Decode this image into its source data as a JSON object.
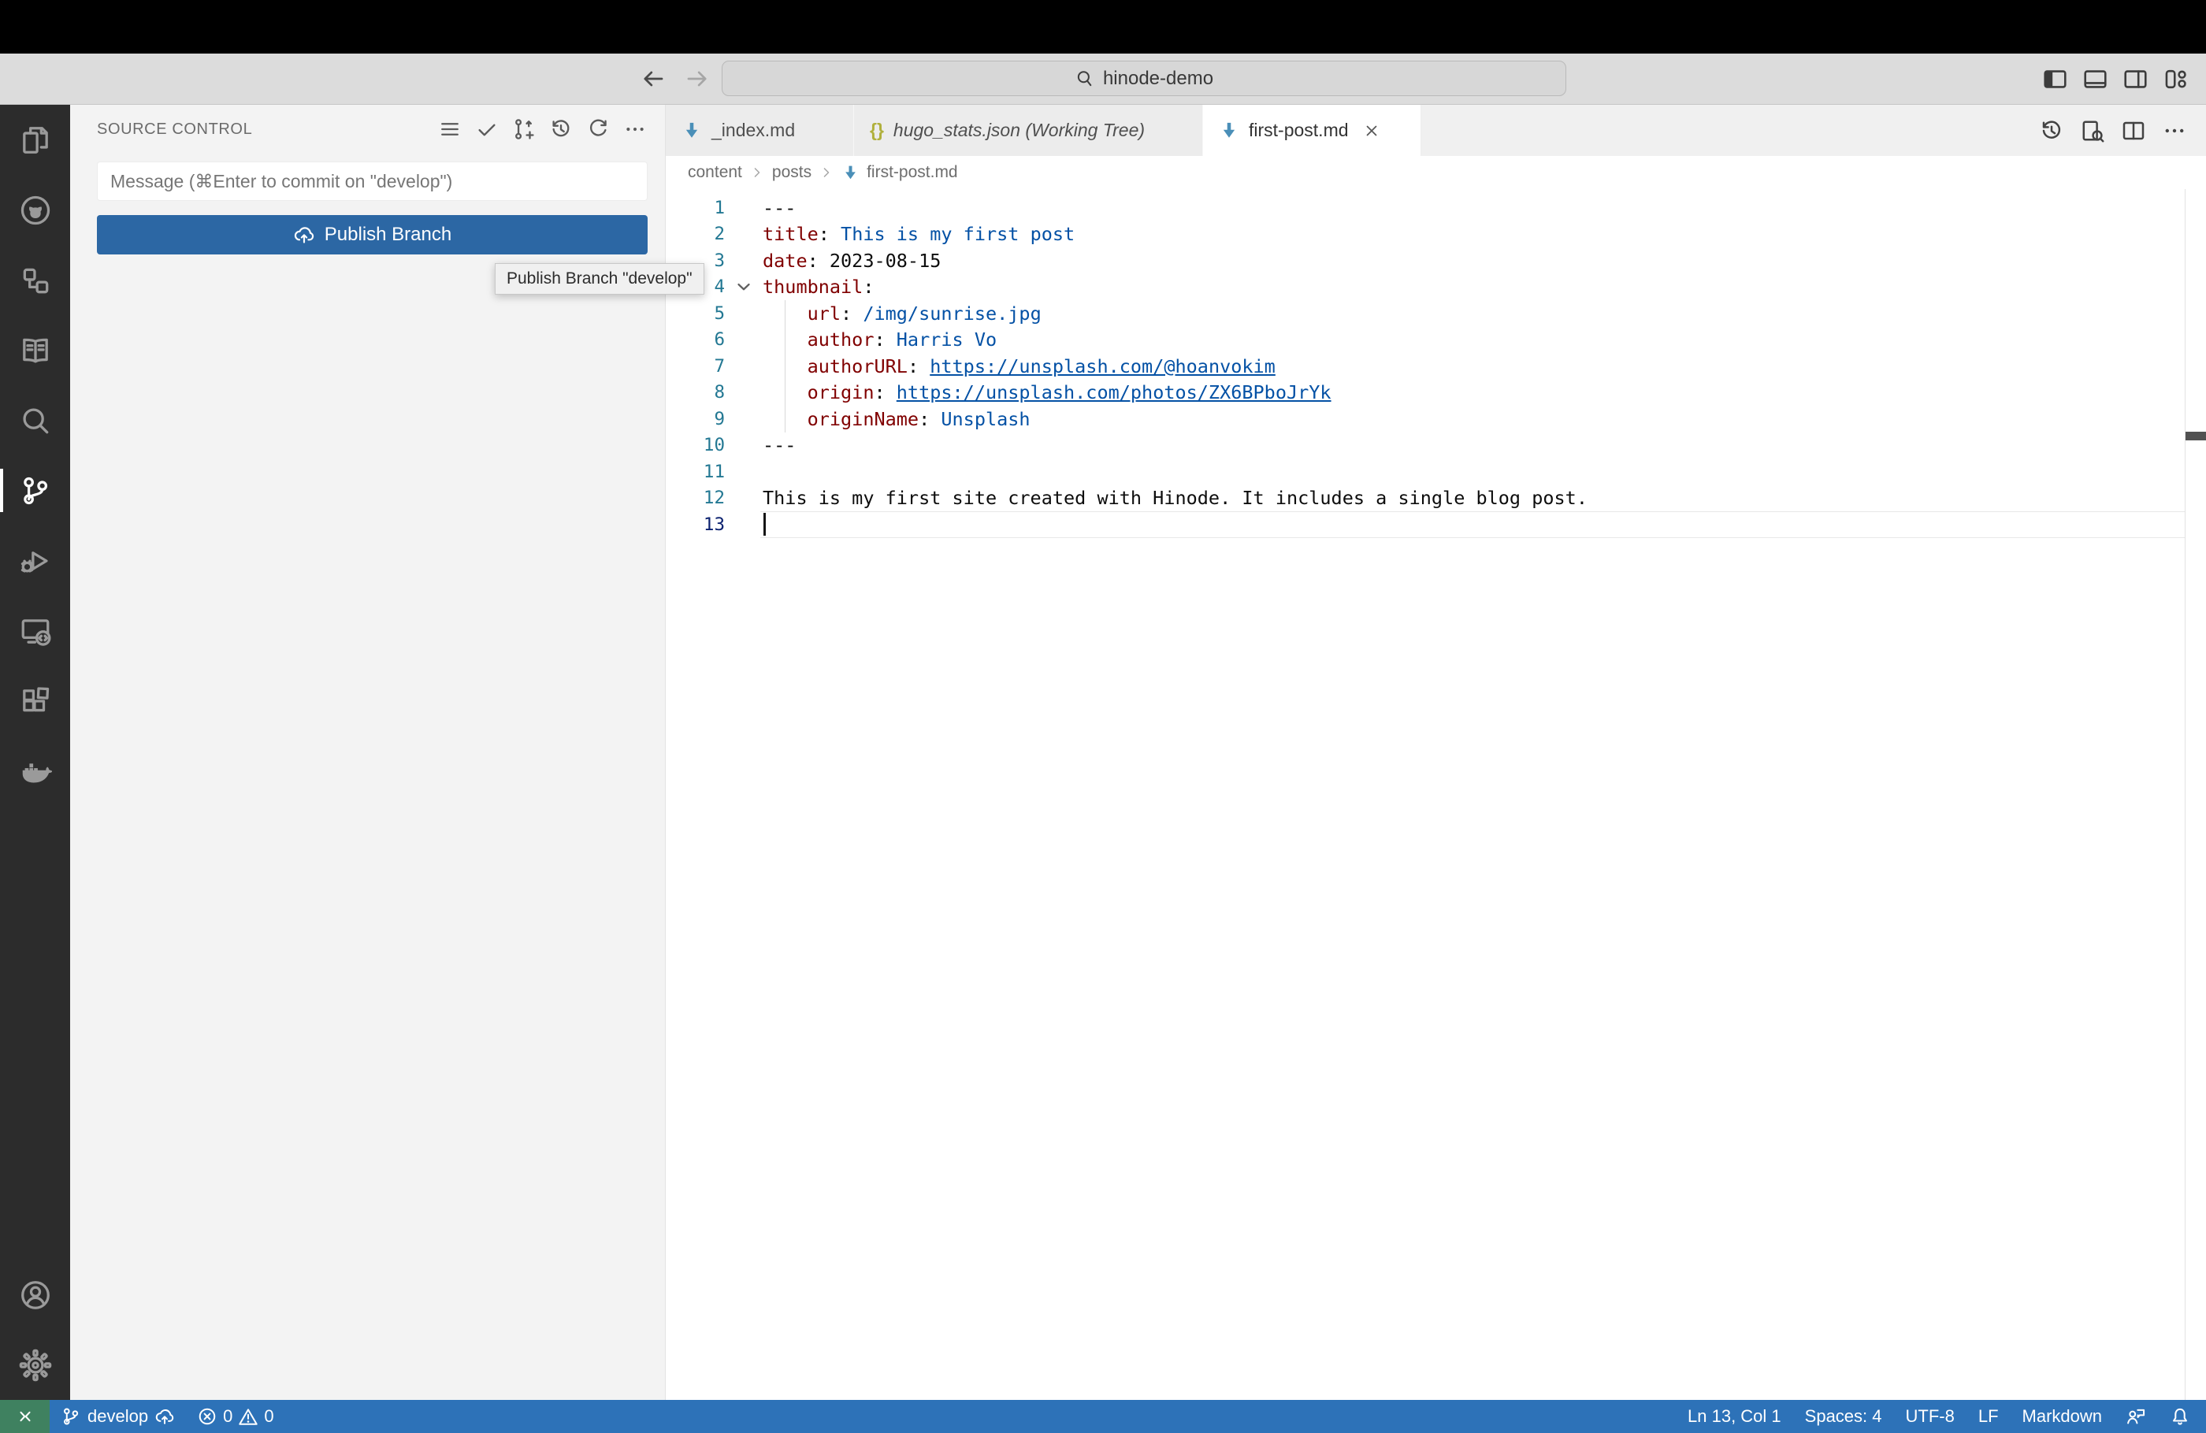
{
  "title_bar": {
    "search_value": "hinode-demo"
  },
  "activity_bar": {
    "items": [
      "explorer",
      "github",
      "project-hierarchy",
      "docs-book",
      "search",
      "source-control",
      "run-and-debug",
      "remote-explorer",
      "extensions",
      "docker",
      "account",
      "settings"
    ],
    "active_item": "source-control"
  },
  "sidebar": {
    "title": "SOURCE CONTROL",
    "commit_input": {
      "value": "",
      "placeholder": "Message (⌘Enter to commit on \"develop\")"
    },
    "publish_button": "Publish Branch",
    "tooltip": "Publish Branch \"develop\"",
    "header_icons": [
      "view-as-list",
      "commit-check",
      "branch-create",
      "history",
      "refresh",
      "more-actions"
    ]
  },
  "tabs": [
    {
      "label": "_index.md",
      "icon": "markdown",
      "active": false
    },
    {
      "label": "hugo_stats.json (Working Tree)",
      "icon": "json",
      "active": false,
      "italic": true
    },
    {
      "label": "first-post.md",
      "icon": "markdown",
      "active": true,
      "closable": true
    }
  ],
  "breadcrumb": {
    "items": [
      "content",
      "posts",
      "first-post.md"
    ]
  },
  "editor": {
    "lines": [
      {
        "num": 1,
        "tokens": [
          [
            "---",
            "plain"
          ]
        ]
      },
      {
        "num": 2,
        "tokens": [
          [
            "title",
            "key"
          ],
          [
            ": ",
            "plain"
          ],
          [
            "This is my first post",
            "str"
          ]
        ]
      },
      {
        "num": 3,
        "tokens": [
          [
            "date",
            "key"
          ],
          [
            ": ",
            "plain"
          ],
          [
            "2023-08-15",
            "plain"
          ]
        ]
      },
      {
        "num": 4,
        "fold": true,
        "tokens": [
          [
            "thumbnail",
            "key"
          ],
          [
            ":",
            "plain"
          ]
        ]
      },
      {
        "num": 5,
        "guide": true,
        "tokens": [
          [
            "    ",
            "plain"
          ],
          [
            "url",
            "key"
          ],
          [
            ": ",
            "plain"
          ],
          [
            "/img/sunrise.jpg",
            "str"
          ]
        ]
      },
      {
        "num": 6,
        "guide": true,
        "tokens": [
          [
            "    ",
            "plain"
          ],
          [
            "author",
            "key"
          ],
          [
            ": ",
            "plain"
          ],
          [
            "Harris Vo",
            "str"
          ]
        ]
      },
      {
        "num": 7,
        "guide": true,
        "tokens": [
          [
            "    ",
            "plain"
          ],
          [
            "authorURL",
            "key"
          ],
          [
            ": ",
            "plain"
          ],
          [
            "https://unsplash.com/@hoanvokim",
            "link"
          ]
        ]
      },
      {
        "num": 8,
        "guide": true,
        "tokens": [
          [
            "    ",
            "plain"
          ],
          [
            "origin",
            "key"
          ],
          [
            ": ",
            "plain"
          ],
          [
            "https://unsplash.com/photos/ZX6BPboJrYk",
            "link"
          ]
        ]
      },
      {
        "num": 9,
        "guide": true,
        "tokens": [
          [
            "    ",
            "plain"
          ],
          [
            "originName",
            "key"
          ],
          [
            ": ",
            "plain"
          ],
          [
            "Unsplash",
            "str"
          ]
        ]
      },
      {
        "num": 10,
        "tokens": [
          [
            "---",
            "plain"
          ]
        ]
      },
      {
        "num": 11,
        "tokens": []
      },
      {
        "num": 12,
        "tokens": [
          [
            "This is my first site created with Hinode. It includes a single blog post.",
            "plain"
          ]
        ]
      },
      {
        "num": 13,
        "current": true,
        "cursor": true,
        "tokens": []
      }
    ]
  },
  "status_bar": {
    "branch": "develop",
    "errors": "0",
    "warnings": "0",
    "line_col": "Ln 13, Col 1",
    "indent": "Spaces: 4",
    "encoding": "UTF-8",
    "eol": "LF",
    "language": "Markdown"
  },
  "colors": {
    "accent": "#2c67a4",
    "status": "#2d72b8",
    "remote": "#3f8160",
    "activity": "#2c2c2c",
    "sidebar": "#f3f3f3",
    "titlebar": "#dcdcdc",
    "tab-inactive": "#ececec",
    "ykey": "#800000",
    "ystr": "#0451a5",
    "lnum": "#237893",
    "md": "#4a8fb8",
    "json": "#b0b03c"
  }
}
